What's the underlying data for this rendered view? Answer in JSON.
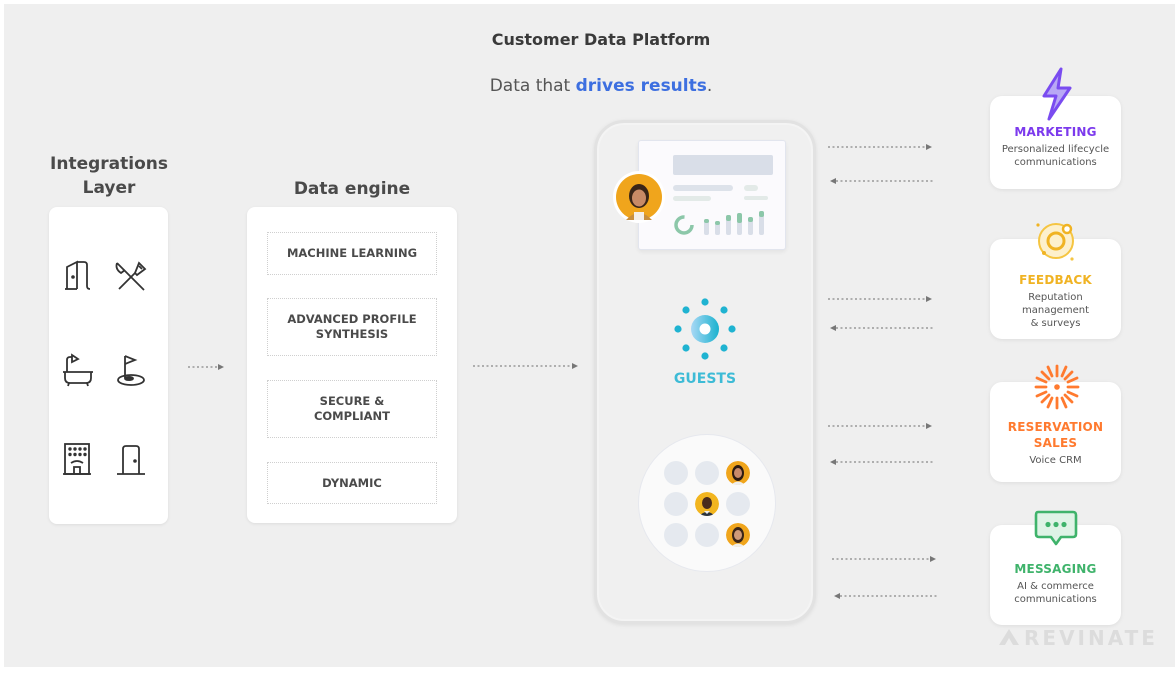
{
  "header": {
    "title": "Customer Data Platform",
    "subtitle_prefix": "Data that ",
    "subtitle_highlight": "drives results",
    "subtitle_suffix": "."
  },
  "integrations": {
    "heading_line1": "Integrations",
    "heading_line2": "Layer",
    "icons": [
      "door-open-icon",
      "cutlery-icon",
      "bathtub-icon",
      "golf-flag-icon",
      "hotel-building-icon",
      "door-icon"
    ]
  },
  "engine": {
    "heading": "Data engine",
    "items": [
      {
        "line1": "MACHINE LEARNING",
        "line2": ""
      },
      {
        "line1": "ADVANCED PROFILE",
        "line2": "SYNTHESIS"
      },
      {
        "line1": "SECURE &",
        "line2": "COMPLIANT"
      },
      {
        "line1": "DYNAMIC",
        "line2": ""
      }
    ]
  },
  "center": {
    "label": "GUESTS",
    "accent": "#3dbbd6"
  },
  "products": [
    {
      "title": "MARKETING",
      "title2": "",
      "desc1": "Personalized lifecycle",
      "desc2": "communications",
      "desc3": "",
      "color": "#7c3aed",
      "icon": "lightning-icon"
    },
    {
      "title": "FEEDBACK",
      "title2": "",
      "desc1": "Reputation",
      "desc2": "management",
      "desc3": "& surveys",
      "color": "#f0b323",
      "icon": "orbit-icon"
    },
    {
      "title": "RESERVATION",
      "title2": "SALES",
      "desc1": "Voice CRM",
      "desc2": "",
      "desc3": "",
      "color": "#ff7a2f",
      "icon": "starburst-icon"
    },
    {
      "title": "MESSAGING",
      "title2": "",
      "desc1": "AI & commerce",
      "desc2": "communications",
      "desc3": "",
      "color": "#3fb36b",
      "icon": "chat-bubble-icon"
    }
  ],
  "brand": "REVINATE"
}
